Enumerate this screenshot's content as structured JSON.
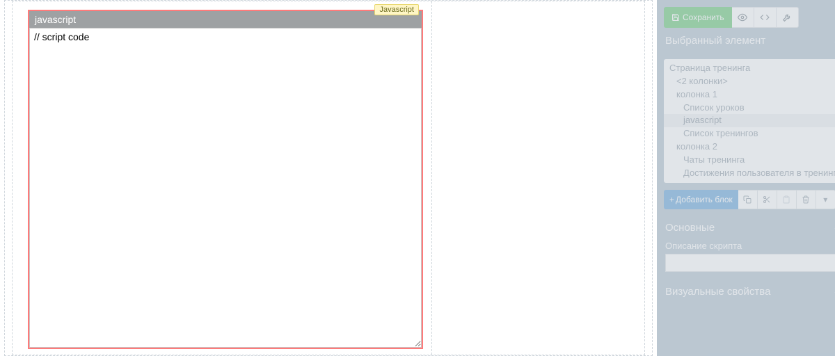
{
  "editor": {
    "block_title": "javascript",
    "badge": "Javascript",
    "code": "// script code"
  },
  "toolbar": {
    "save_label": "Сохранить"
  },
  "sections": {
    "selected_element": "Выбранный элемент",
    "main": "Основные",
    "visual": "Визуальные свойства"
  },
  "tree": {
    "items": [
      {
        "label": "Страница тренинга",
        "level": 0
      },
      {
        "label": "<2 колонки>",
        "level": 1
      },
      {
        "label": "колонка 1",
        "level": 1
      },
      {
        "label": "Список уроков",
        "level": 2
      },
      {
        "label": "javascript",
        "level": 2,
        "selected": true
      },
      {
        "label": "Список тренингов",
        "level": 2
      },
      {
        "label": "колонка 2",
        "level": 1
      },
      {
        "label": "Чаты тренинга",
        "level": 2
      },
      {
        "label": "Достижения пользователя в тренинге",
        "level": 2
      }
    ]
  },
  "actions": {
    "add_block": "Добавить блок"
  },
  "fields": {
    "script_description_label": "Описание скрипта",
    "script_description_value": ""
  }
}
